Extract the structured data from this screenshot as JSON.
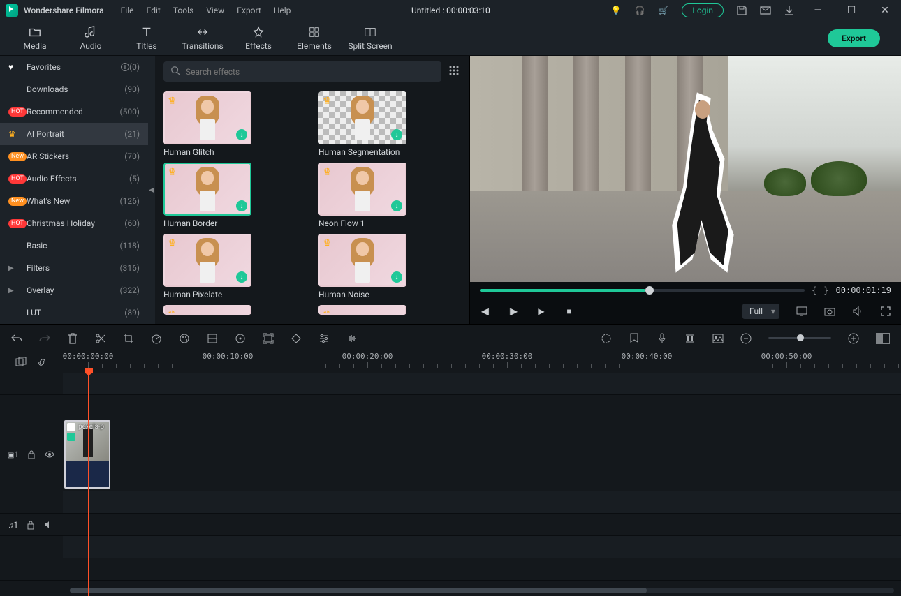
{
  "app": {
    "name": "Wondershare Filmora",
    "title": "Untitled : 00:00:03:10"
  },
  "menubar": [
    "File",
    "Edit",
    "Tools",
    "View",
    "Export",
    "Help"
  ],
  "login": "Login",
  "tabs": [
    {
      "id": "media",
      "label": "Media"
    },
    {
      "id": "audio",
      "label": "Audio"
    },
    {
      "id": "titles",
      "label": "Titles"
    },
    {
      "id": "transitions",
      "label": "Transitions"
    },
    {
      "id": "effects",
      "label": "Effects",
      "active": true
    },
    {
      "id": "elements",
      "label": "Elements"
    },
    {
      "id": "split-screen",
      "label": "Split Screen"
    }
  ],
  "export_label": "Export",
  "sidebar": [
    {
      "icon": "heart",
      "label": "Favorites",
      "info": true,
      "count": "(0)"
    },
    {
      "icon": "",
      "label": "Downloads",
      "count": "(90)"
    },
    {
      "icon": "hot",
      "label": "Recommended",
      "count": "(500)"
    },
    {
      "icon": "crown",
      "label": "AI Portrait",
      "count": "(21)",
      "selected": true
    },
    {
      "icon": "new",
      "label": "AR Stickers",
      "count": "(70)"
    },
    {
      "icon": "hot",
      "label": "Audio Effects",
      "count": "(5)"
    },
    {
      "icon": "new",
      "label": "What's New",
      "count": "(126)"
    },
    {
      "icon": "hot",
      "label": "Christmas Holiday",
      "count": "(60)"
    },
    {
      "icon": "",
      "label": "Basic",
      "count": "(118)"
    },
    {
      "icon": "arrow",
      "label": "Filters",
      "count": "(316)"
    },
    {
      "icon": "arrow",
      "label": "Overlay",
      "count": "(322)"
    },
    {
      "icon": "",
      "label": "LUT",
      "count": "(89)"
    }
  ],
  "search": {
    "placeholder": "Search effects"
  },
  "effects": [
    {
      "label": "Human Glitch",
      "premium": true,
      "dl": true
    },
    {
      "label": "Human Segmentation",
      "premium": true,
      "dl": true,
      "checker": true
    },
    {
      "label": "Human Border",
      "premium": true,
      "dl": true,
      "selected": true,
      "border": true
    },
    {
      "label": "Neon Flow 1",
      "premium": true,
      "dl": true
    },
    {
      "label": "Human Pixelate",
      "premium": true,
      "dl": true
    },
    {
      "label": "Human Noise",
      "premium": true,
      "dl": true
    }
  ],
  "preview": {
    "timecode": "00:00:01:19",
    "quality": "Full"
  },
  "timeline": {
    "marks": [
      "00:00:00:00",
      "00:00:10:00",
      "00:00:20:00",
      "00:00:30:00",
      "00:00:40:00",
      "00:00:50:00"
    ],
    "clip_label": "pexels-p",
    "video_track_label": "1",
    "audio_track_label": "1"
  }
}
